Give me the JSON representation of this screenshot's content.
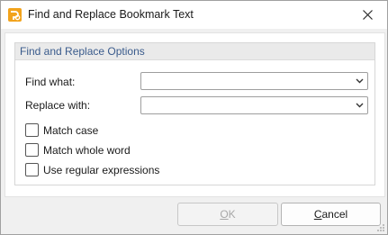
{
  "window": {
    "title": "Find and Replace Bookmark Text"
  },
  "group": {
    "title": "Find and Replace Options"
  },
  "find": {
    "label": "Find what:",
    "value": ""
  },
  "replace": {
    "label": "Replace with:",
    "value": ""
  },
  "options": {
    "match_case": {
      "label": "Match case",
      "checked": false
    },
    "match_whole_word": {
      "label": "Match whole word",
      "checked": false
    },
    "regex": {
      "label": "Use regular expressions",
      "checked": false
    }
  },
  "buttons": {
    "ok_mnemonic": "O",
    "ok_rest": "K",
    "cancel_mnemonic": "C",
    "cancel_rest": "ancel"
  },
  "colors": {
    "group_title": "#3a5b8c",
    "app_icon": "#f2a31c",
    "disabled_text": "#a8a8a8"
  },
  "icons": {
    "app": "pdf-app-icon",
    "close": "close-icon",
    "dropdown": "chevron-down-icon"
  }
}
